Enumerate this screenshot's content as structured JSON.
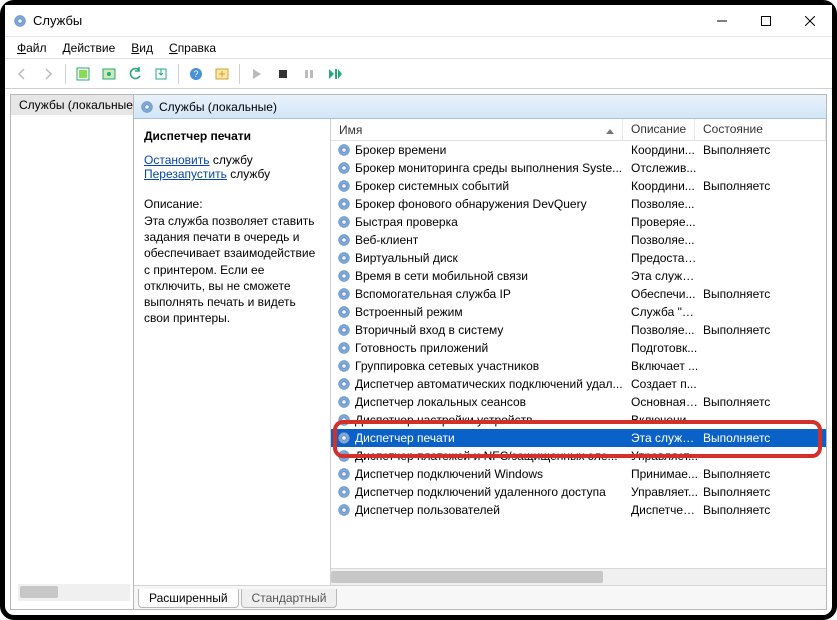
{
  "window": {
    "title": "Службы"
  },
  "menu": {
    "file": "Файл",
    "action": "Действие",
    "view": "Вид",
    "help": "Справка"
  },
  "tree": {
    "root": "Службы (локальные)"
  },
  "panel": {
    "heading": "Службы (локальные)"
  },
  "detail": {
    "selected_title": "Диспетчер печати",
    "stop_link": "Остановить",
    "restart_link": "Перезапустить",
    "service_word": " службу",
    "desc_label": "Описание:",
    "desc_text": "Эта служба позволяет ставить задания печати в очередь и обеспечивает взаимодействие с принтером. Если ее отключить, вы не сможете выполнять печать и видеть свои принтеры."
  },
  "columns": {
    "name": "Имя",
    "desc": "Описание",
    "state": "Состояние"
  },
  "rows": [
    {
      "name": "Брокер времени",
      "desc": "Координи...",
      "state": "Выполняетс"
    },
    {
      "name": "Брокер мониторинга среды выполнения Syste...",
      "desc": "Отслежив...",
      "state": ""
    },
    {
      "name": "Брокер системных событий",
      "desc": "Координи...",
      "state": "Выполняетс"
    },
    {
      "name": "Брокер фонового обнаружения DevQuery",
      "desc": "Позволяе...",
      "state": ""
    },
    {
      "name": "Быстрая проверка",
      "desc": "Проверяе...",
      "state": ""
    },
    {
      "name": "Веб-клиент",
      "desc": "Позволяе...",
      "state": ""
    },
    {
      "name": "Виртуальный диск",
      "desc": "Предостав...",
      "state": ""
    },
    {
      "name": "Время в сети мобильной связи",
      "desc": "Эта служб...",
      "state": ""
    },
    {
      "name": "Вспомогательная служба IP",
      "desc": "Обеспечи...",
      "state": "Выполняетс"
    },
    {
      "name": "Встроенный режим",
      "desc": "Служба \"В...",
      "state": ""
    },
    {
      "name": "Вторичный вход в систему",
      "desc": "Позволяе...",
      "state": "Выполняетс"
    },
    {
      "name": "Готовность приложений",
      "desc": "Подготовк...",
      "state": ""
    },
    {
      "name": "Группировка сетевых участников",
      "desc": "Включает ...",
      "state": ""
    },
    {
      "name": "Диспетчер автоматических подключений удал...",
      "desc": "Создает п...",
      "state": ""
    },
    {
      "name": "Диспетчер локальных сеансов",
      "desc": "Основная ...",
      "state": "Выполняетс"
    },
    {
      "name": "Диспетчер настройки устройств",
      "desc": "Включени...",
      "state": ""
    },
    {
      "name": "Диспетчер печати",
      "desc": "Эта служб...",
      "state": "Выполняетс",
      "selected": true
    },
    {
      "name": "Диспетчер платежей и NFC/защищенных эле...",
      "desc": "Управляет...",
      "state": ""
    },
    {
      "name": "Диспетчер подключений Windows",
      "desc": "Принимае...",
      "state": "Выполняетс"
    },
    {
      "name": "Диспетчер подключений удаленного доступа",
      "desc": "Управляет...",
      "state": "Выполняетс"
    },
    {
      "name": "Диспетчер пользователей",
      "desc": "Диспетчер...",
      "state": "Выполняетс"
    }
  ],
  "tabs": {
    "ext": "Расширенный",
    "std": "Стандартный"
  }
}
